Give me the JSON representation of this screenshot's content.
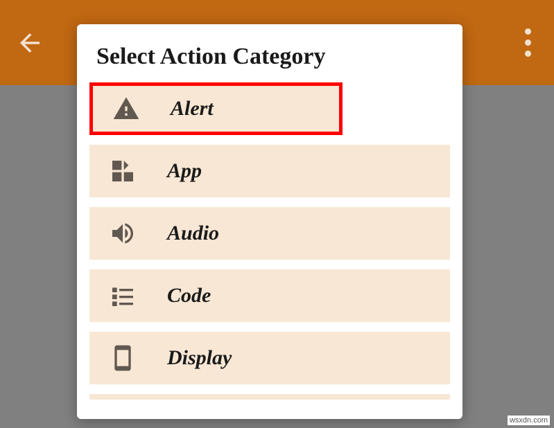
{
  "dialog": {
    "title": "Select Action Category"
  },
  "categories": [
    {
      "label": "Alert",
      "icon": "alert",
      "highlighted": true
    },
    {
      "label": "App",
      "icon": "app",
      "highlighted": false
    },
    {
      "label": "Audio",
      "icon": "audio",
      "highlighted": false
    },
    {
      "label": "Code",
      "icon": "code",
      "highlighted": false
    },
    {
      "label": "Display",
      "icon": "display",
      "highlighted": false
    }
  ],
  "watermark": "wsxdn.com"
}
